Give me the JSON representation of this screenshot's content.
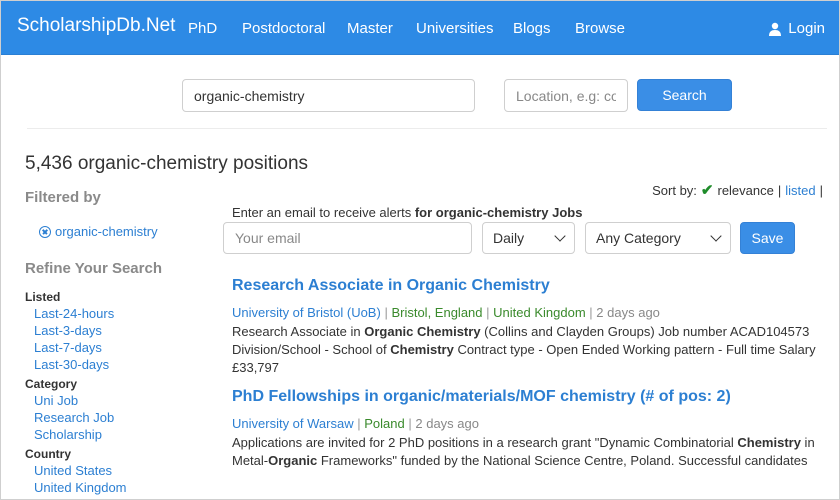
{
  "navbar": {
    "brand": "ScholarshipDb.Net",
    "items": [
      "PhD",
      "Postdoctoral",
      "Master",
      "Universities",
      "Blogs",
      "Browse"
    ],
    "login_label": "Login"
  },
  "search": {
    "query_value": "organic-chemistry",
    "location_placeholder": "Location, e.g: co",
    "button_label": "Search"
  },
  "results": {
    "title": "5,436 organic-chemistry positions"
  },
  "sidebar": {
    "filtered_by_heading": "Filtered by",
    "active_filter": "organic-chemistry",
    "refine_heading": "Refine Your Search",
    "groups": [
      {
        "heading": "Listed",
        "items": [
          "Last-24-hours",
          "Last-3-days",
          "Last-7-days",
          "Last-30-days"
        ]
      },
      {
        "heading": "Category",
        "items": [
          "Uni Job",
          "Research Job",
          "Scholarship"
        ]
      },
      {
        "heading": "Country",
        "items": [
          "United States",
          "United Kingdom"
        ]
      }
    ]
  },
  "sort": {
    "label": "Sort by:",
    "active": "relevance",
    "sep": "|",
    "other": "listed"
  },
  "alert": {
    "text_prefix": "Enter an email to receive alerts",
    "text_bold": "for organic-chemistry Jobs",
    "email_placeholder": "Your email",
    "frequency_selected": "Daily",
    "category_selected": "Any Category",
    "save_label": "Save"
  },
  "jobs": [
    {
      "title": "Research Associate in Organic Chemistry",
      "university": "University of Bristol (UoB)",
      "city": "Bristol, England",
      "country": "United Kingdom",
      "age": "2 days ago",
      "description_html": "Research Associate in <b>Organic Chemistry</b> (Collins and Clayden Groups) Job number ACAD104573 Division/School - School of <b>Chemistry</b> Contract type - Open Ended Working pattern - Full time Salary £33,797"
    },
    {
      "title": "PhD Fellowships in organic/materials/MOF chemistry (# of pos: 2)",
      "university": "University of Warsaw",
      "city": "",
      "country": "Poland",
      "age": "2 days ago",
      "description_html": "Applications are invited for 2 PhD positions in a research grant \"Dynamic Combinatorial <b>Chemistry</b> in Metal-<b>Organic</b> Frameworks\" funded by the National Science Centre, Poland. Successful candidates"
    }
  ],
  "colors": {
    "navbar_bg": "#2d8ae5",
    "link": "#2c7fd2",
    "location_green": "#3a8a2c",
    "button": "#3a8ee6"
  }
}
